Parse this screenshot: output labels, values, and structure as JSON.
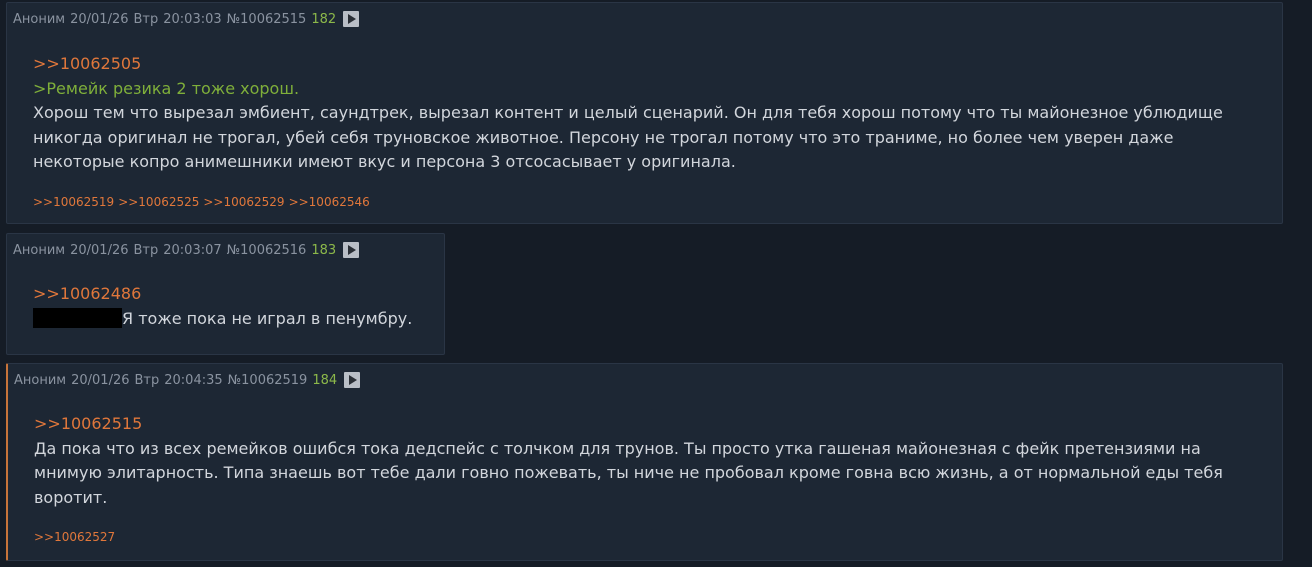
{
  "posts": [
    {
      "name": "Аноним",
      "date": "20/01/26",
      "weekday": "Втр",
      "time": "20:03:03",
      "num": "№10062515",
      "count": "182",
      "quote_link": ">>10062505",
      "greentext": ">Ремейк резика 2 тоже хорош.",
      "lines": [
        "Хорош тем что вырезал эмбиент, саундтрек, вырезал контент и целый сценарий. Он для тебя хорош потому что ты майонезное ублюдище",
        "никогда оригинал не трогал, убей себя труновское животное. Персону не трогал потому что это траниме, но более чем уверен даже",
        "некоторые копро анимешники имеют вкус и персона 3 отсосасывает у оригинала."
      ],
      "replies": [
        ">>10062519",
        ">>10062525",
        ">>10062529",
        ">>10062546"
      ]
    },
    {
      "name": "Аноним",
      "date": "20/01/26",
      "weekday": "Втр",
      "time": "20:03:07",
      "num": "№10062516",
      "count": "183",
      "quote_link": ">>10062486",
      "after_spoiler": "Я тоже пока не играл в пенумбру."
    },
    {
      "name": "Аноним",
      "date": "20/01/26",
      "weekday": "Втр",
      "time": "20:04:35",
      "num": "№10062519",
      "count": "184",
      "quote_link": ">>10062515",
      "lines": [
        "Да пока что из всех ремейков ошибся тока дедспейс с толчком для трунов. Ты просто утка гашеная майонезная с фейк претензиями на",
        "мнимую элитарность. Типа знаешь вот тебе дали говно пожевать, ты ниче не пробовал кроме говна всю жизнь, а от нормальной еды тебя",
        "воротит."
      ],
      "replies": [
        ">>10062527"
      ]
    }
  ]
}
